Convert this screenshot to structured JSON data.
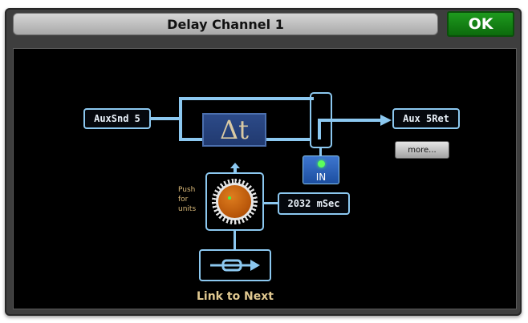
{
  "window": {
    "title": "Delay Channel 1",
    "ok_label": "OK"
  },
  "routing": {
    "input_label": "AuxSnd 5",
    "output_label": "Aux 5Ret",
    "delay_symbol": "Δt",
    "in_switch_label": "IN",
    "in_switch_led": "on",
    "more_label": "more...",
    "push_hint": [
      "Push",
      "for",
      "units"
    ],
    "delay_value": "2032  mSec",
    "link_label": "Link to Next"
  },
  "colors": {
    "wire": "#8cc8f0",
    "ok_green": "#1e9a1e",
    "knob_orange": "#c8610f",
    "led_green": "#5cff5c"
  },
  "icons": [
    "delay-icon",
    "link-icon",
    "up-arrow-icon",
    "right-arrow-icon"
  ]
}
